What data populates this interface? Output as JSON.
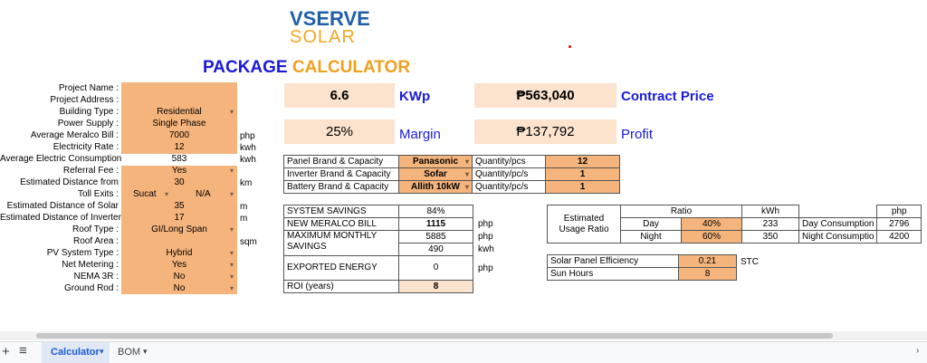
{
  "logo": {
    "line1": "VSERVE",
    "line2": "SOLAR"
  },
  "title": {
    "part1": "PACKAGE ",
    "part2": "CALCULATOR"
  },
  "colors": {
    "accent_orange": "#f4b47c",
    "light_orange": "#fbe3cd",
    "title_blue": "#1a1adb",
    "title_orange": "#f0a020",
    "logo_blue": "#1f5fa6",
    "logo_orange": "#f5a623"
  },
  "left_labels": [
    "Project Name :",
    "Project Address :",
    "Building Type :",
    "Power Supply :",
    "Average Meralco Bill :",
    "Electricity Rate :",
    "Average Electric Consumption :",
    "Referral Fee :",
    "Estimated Distance from",
    "Toll Exits :",
    "Estimated Distance of Solar",
    "Estimated Distance of Inverter",
    "Roof Type :",
    "Roof Area :",
    "PV System Type :",
    "Net Metering :",
    "NEMA 3R :",
    "Ground Rod :"
  ],
  "left_values": {
    "building_type": "Residential",
    "power_supply": "Single Phase",
    "meralco_bill": "7000",
    "electricity_rate": "12",
    "consumption": "583",
    "referral_fee": "Yes",
    "distance_from": "30",
    "toll_a": "Sucat",
    "toll_b": "N/A",
    "distance_solar": "35",
    "distance_inverter": "17",
    "roof_type": "GI/Long Span",
    "pv_system": "Hybrid",
    "net_metering": "Yes",
    "nema": "No",
    "ground_rod": "No"
  },
  "units": {
    "php": "php",
    "kwh": "kwh",
    "kwh2": "kwh",
    "km": "km",
    "m1": "m",
    "m2": "m",
    "sqm": "sqm"
  },
  "summary": {
    "kwp_value": "6.6",
    "kwp_label": "KWp",
    "price_value": "₱563,040",
    "price_label": "Contract Price",
    "margin_value": "25%",
    "margin_label": "Margin",
    "profit_value": "₱137,792",
    "profit_label": "Profit"
  },
  "brands": [
    {
      "label": "Panel Brand & Capacity",
      "value": "Panasonic",
      "qty_label": "Quantity/pcs",
      "qty": "12"
    },
    {
      "label": "Inverter Brand & Capacity",
      "value": "Sofar",
      "qty_label": "Quantity/pc/s",
      "qty": "1"
    },
    {
      "label": "Battery Brand & Capacity",
      "value": "Allith 10kW",
      "qty_label": "Quantity/pc/s",
      "qty": "1"
    }
  ],
  "savings": {
    "system_savings_label": "SYSTEM SAVINGS",
    "system_savings": "84%",
    "new_bill_label": "NEW MERALCO BILL",
    "new_bill": "1115",
    "new_bill_unit": "php",
    "monthly_label": "MAXIMUM MONTHLY SAVINGS",
    "monthly_php": "5885",
    "monthly_php_unit": "php",
    "monthly_kwh": "490",
    "monthly_kwh_unit": "kwh",
    "exported_label": "EXPORTED ENERGY",
    "exported": "0",
    "exported_unit": "php",
    "roi_label": "ROI (years)",
    "roi": "8"
  },
  "usage": {
    "label": "Estimated Usage Ratio",
    "ratio_header": "Ratio",
    "kwh_header": "kWh",
    "php_header": "php",
    "day_label": "Day",
    "day_ratio": "40%",
    "day_kwh": "233",
    "day_cons_label": "Day Consumption",
    "day_php": "2796",
    "night_label": "Night",
    "night_ratio": "60%",
    "night_kwh": "350",
    "night_cons_label": "Night Consumptio",
    "night_php": "4200"
  },
  "efficiency": {
    "eff_label": "Solar Panel Efficiency",
    "eff_value": "0.21",
    "eff_unit": "STC",
    "sun_label": "Sun Hours",
    "sun_value": "8"
  },
  "tabs": {
    "add": "+",
    "menu": "≡",
    "calc": "Calculator",
    "bom": "BOM"
  }
}
